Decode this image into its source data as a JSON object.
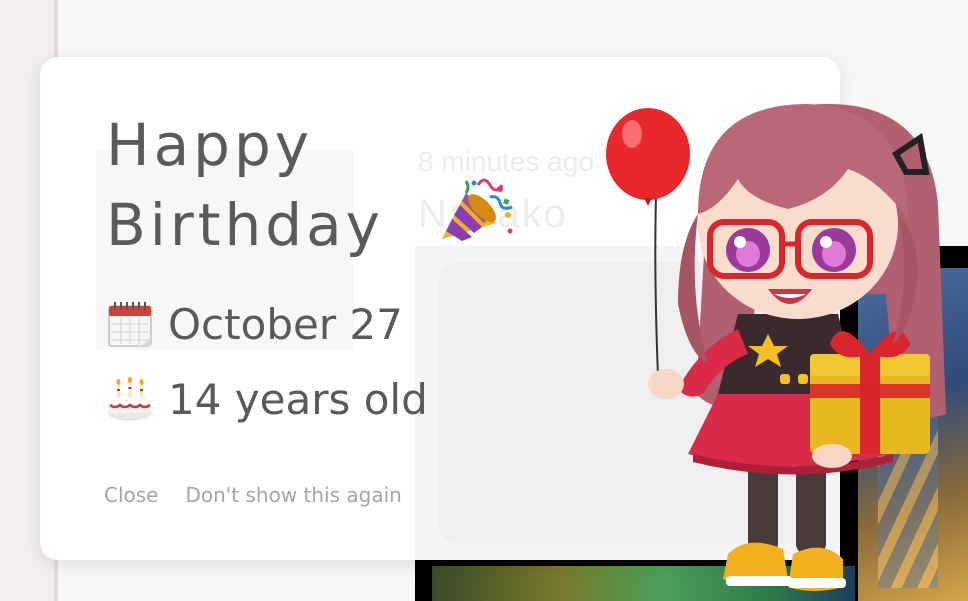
{
  "background": {
    "post_meta": "8 minutes ago",
    "post_name": "Nanako"
  },
  "modal": {
    "title_line1": "Happy",
    "title_line2": "Birthday",
    "title_icon": "party-popper-icon",
    "birthday": {
      "icon": "calendar-icon",
      "text": "October 27"
    },
    "age": {
      "icon": "birthday-cake-icon",
      "text": "14 years old"
    },
    "actions": {
      "close_label": "Close",
      "dont_show_label": "Don't show this again"
    }
  },
  "colors": {
    "text": "#5a5a5a",
    "action_text": "#a6a6a6",
    "modal_bg": "#ffffff",
    "page_bg": "#f7f7f8",
    "balloon": "#e8282c",
    "gift_box": "#e8b820",
    "gift_ribbon": "#d8262c"
  }
}
